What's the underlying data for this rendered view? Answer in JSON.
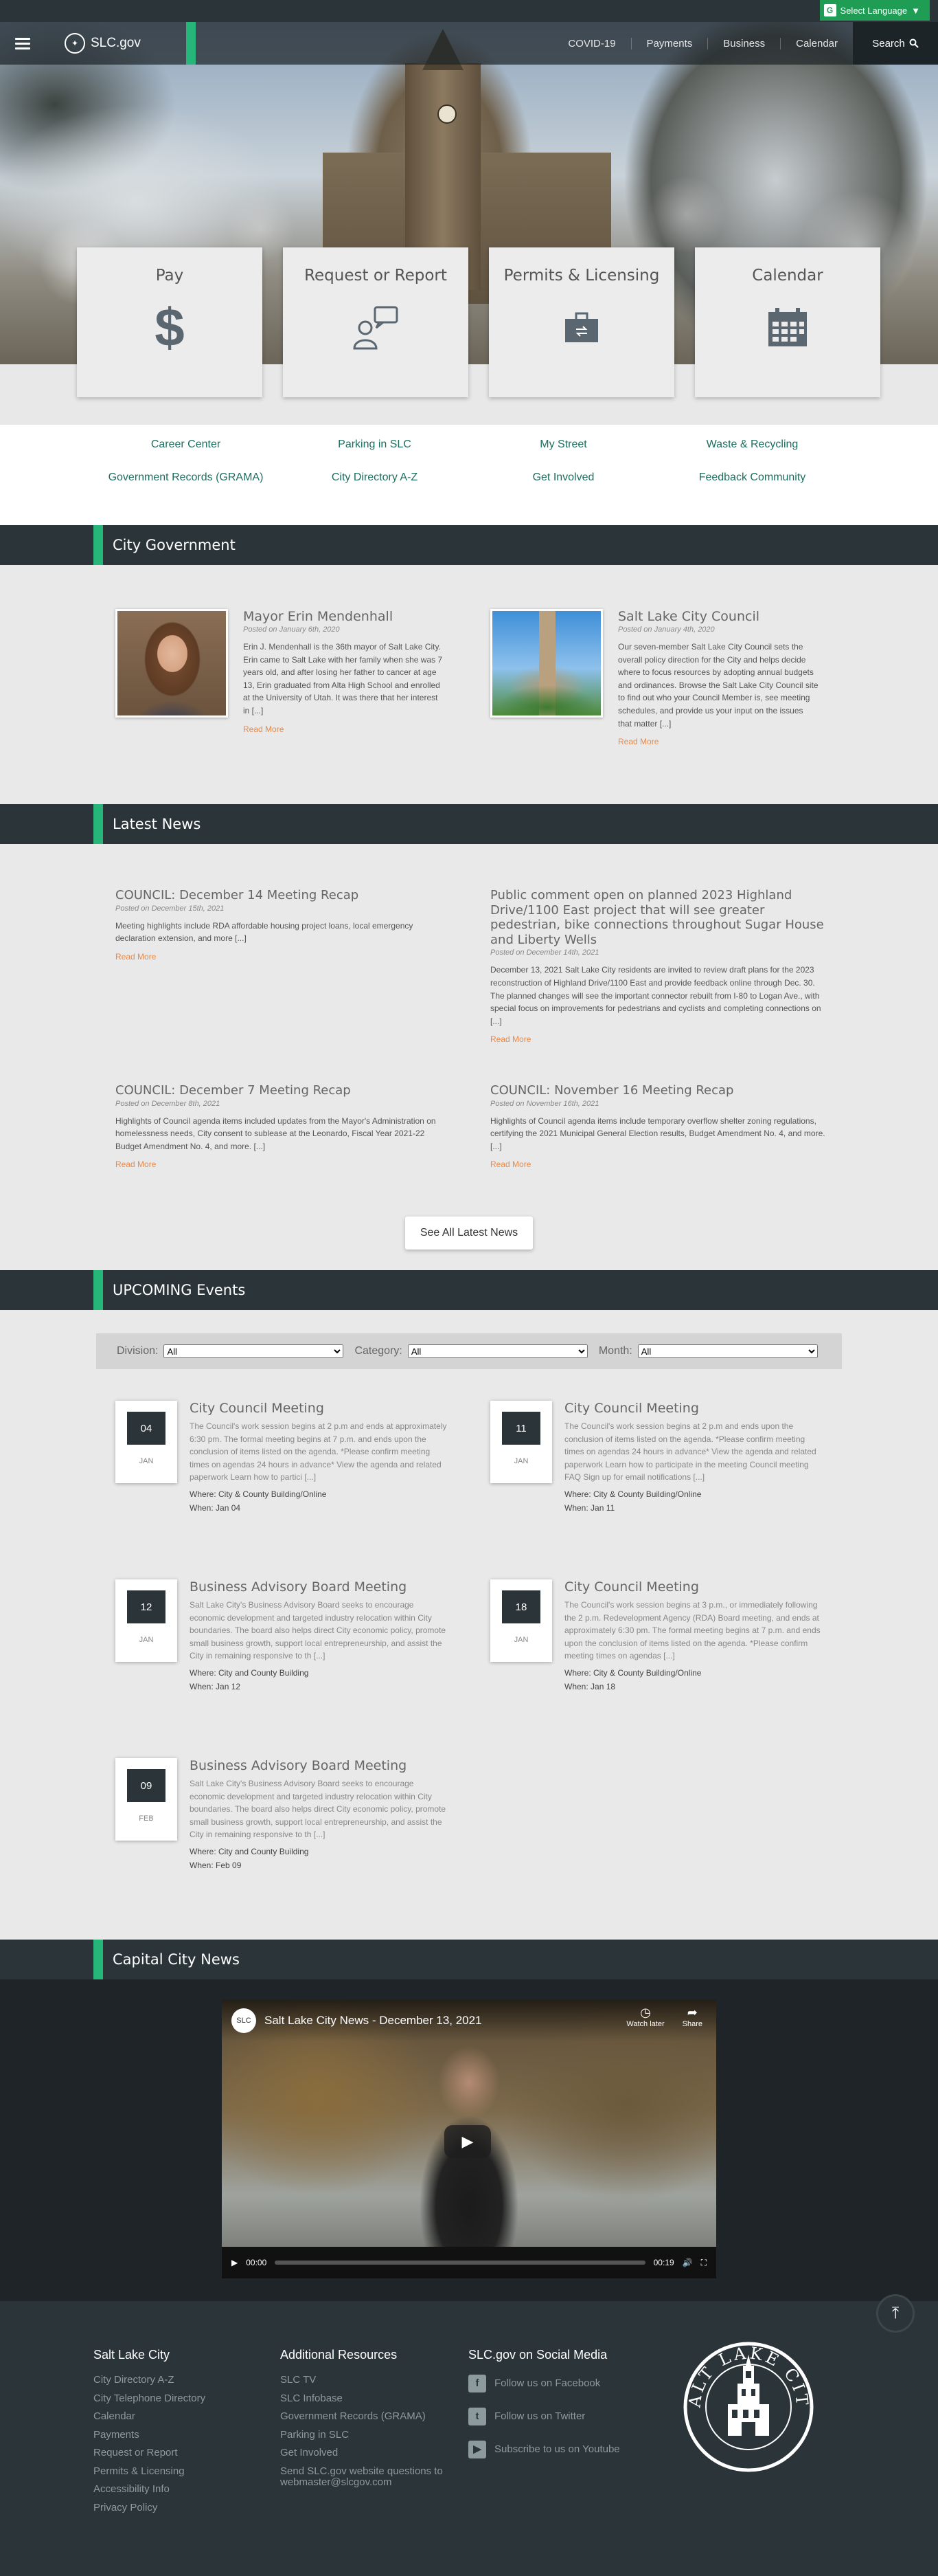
{
  "language": {
    "label": "Select Language"
  },
  "header": {
    "logo": "SLC.gov",
    "nav": [
      "COVID-19",
      "Payments",
      "Business",
      "Calendar"
    ],
    "search_label": "Search"
  },
  "quick_cards": [
    {
      "label": "Pay",
      "icon": "dollar-icon"
    },
    {
      "label": "Request or Report",
      "icon": "person-chat-icon"
    },
    {
      "label": "Permits & Licensing",
      "icon": "briefcase-icon"
    },
    {
      "label": "Calendar",
      "icon": "calendar-icon"
    }
  ],
  "quick_links": [
    [
      "Career Center",
      "Parking in SLC",
      "My Street",
      "Waste & Recycling"
    ],
    [
      "Government Records (GRAMA)",
      "City Directory A-Z",
      "Get Involved",
      "Feedback Community"
    ]
  ],
  "city_government": {
    "heading": "City Government",
    "items": [
      {
        "title": "Mayor Erin Mendenhall",
        "date": "Posted on January 6th, 2020",
        "body": "Erin J. Mendenhall is the 36th mayor of Salt Lake City. Erin came to Salt Lake with her family when she was 7 years old, and after losing her father to cancer at age 13, Erin graduated from Alta High School and enrolled at the University of Utah. It was there that her interest in [...]",
        "more": "Read More"
      },
      {
        "title": "Salt Lake City Council",
        "date": "Posted on January 4th, 2020",
        "body": "Our seven-member Salt Lake City Council sets the overall policy direction for the City and helps decide where to focus resources by adopting annual budgets and ordinances. Browse the Salt Lake City Council site to find out who your Council Member is, see meeting schedules, and provide us your input on the issues that matter [...]",
        "more": "Read More"
      }
    ]
  },
  "latest_news": {
    "heading": "Latest News",
    "items": [
      {
        "title": "COUNCIL: December 14 Meeting Recap",
        "date": "Posted on December 15th, 2021",
        "body": "Meeting highlights include RDA affordable housing project loans, local emergency declaration extension, and more [...]",
        "more": "Read More"
      },
      {
        "title": "Public comment open on planned 2023 Highland Drive/1100 East project that will see greater pedestrian, bike connections throughout Sugar House and Liberty Wells",
        "date": "Posted on December 14th, 2021",
        "body": "December 13, 2021 Salt Lake City residents are invited to review draft plans for the 2023 reconstruction of Highland Drive/1100 East and provide feedback online through Dec. 30. The planned changes will see the important connector rebuilt from I-80 to Logan Ave., with special focus on improvements for pedestrians and cyclists and completing connections on [...]",
        "more": "Read More"
      },
      {
        "title": "COUNCIL: December 7 Meeting Recap",
        "date": "Posted on December 8th, 2021",
        "body": "Highlights of Council agenda items included updates from the Mayor's Administration on homelessness needs, City consent to sublease at the Leonardo, Fiscal Year 2021-22 Budget Amendment No. 4, and more. [...]",
        "more": "Read More"
      },
      {
        "title": "COUNCIL: November 16 Meeting Recap",
        "date": "Posted on November 16th, 2021",
        "body": "Highlights of Council agenda items include temporary overflow shelter zoning regulations, certifying the 2021 Municipal General Election results, Budget Amendment No. 4, and more. [...]",
        "more": "Read More"
      }
    ],
    "see_all": "See All Latest News"
  },
  "events": {
    "heading": "UPCOMING Events",
    "filters": [
      {
        "label": "Division:",
        "value": "All"
      },
      {
        "label": "Category:",
        "value": "All"
      },
      {
        "label": "Month:",
        "value": "All"
      }
    ],
    "items": [
      {
        "day": "04",
        "month": "JAN",
        "title": "City Council Meeting",
        "body": "The Council's work session begins at 2 p.m and ends at approximately 6:30 pm. The formal meeting begins at 7 p.m. and ends upon the conclusion of items listed on the agenda. *Please confirm meeting times on agendas 24 hours in advance* View the agenda and related paperwork Learn how to partici [...]",
        "where": "Where: City & County Building/Online",
        "when": "When: Jan 04"
      },
      {
        "day": "11",
        "month": "JAN",
        "title": "City Council Meeting",
        "body": "The Council's work session begins at 2 p.m and ends upon the conclusion of items listed on the agenda. *Please confirm meeting times on agendas 24 hours in advance* View the agenda and related paperwork Learn how to participate in the meeting Council meeting FAQ Sign up for email notifications [...]",
        "where": "Where: City & County Building/Online",
        "when": "When: Jan 11"
      },
      {
        "day": "12",
        "month": "JAN",
        "title": "Business Advisory Board Meeting",
        "body": "Salt Lake City's Business Advisory Board seeks to encourage economic development and targeted industry relocation within City boundaries. The board also helps direct City economic policy, promote small business growth, support local entrepreneurship, and assist the City in remaining responsive to th [...]",
        "where": "Where: City and County Building",
        "when": "When: Jan 12"
      },
      {
        "day": "18",
        "month": "JAN",
        "title": "City Council Meeting",
        "body": "The Council's work session begins at 3 p.m., or immediately following the 2 p.m. Redevelopment Agency (RDA) Board meeting, and ends at approximately 6:30 pm. The formal meeting begins at 7 p.m. and ends upon the conclusion of items listed on the agenda. *Please confirm meeting times on agendas [...]",
        "where": "Where: City & County Building/Online",
        "when": "When: Jan 18"
      },
      {
        "day": "09",
        "month": "FEB",
        "title": "Business Advisory Board Meeting",
        "body": "Salt Lake City's Business Advisory Board seeks to encourage economic development and targeted industry relocation within City boundaries. The board also helps direct City economic policy, promote small business growth, support local entrepreneurship, and assist the City in remaining responsive to th [...]",
        "where": "Where: City and County Building",
        "when": "When: Feb 09"
      }
    ]
  },
  "capital_news": {
    "heading": "Capital City News",
    "video_title": "Salt Lake City News - December 13, 2021",
    "watch_later": "Watch later",
    "share": "Share",
    "time_current": "00:00",
    "time_total": "00:19"
  },
  "footer": {
    "col1": {
      "heading": "Salt Lake City",
      "links": [
        "City Directory A-Z",
        "City Telephone Directory",
        "Calendar",
        "Payments",
        "Request or Report",
        "Permits & Licensing",
        "Accessibility Info",
        "Privacy Policy"
      ]
    },
    "col2": {
      "heading": "Additional Resources",
      "links": [
        "SLC TV",
        "SLC Infobase",
        "Government Records (GRAMA)",
        "Parking in SLC",
        "Get Involved",
        "Send SLC.gov website questions to webmaster@slcgov.com"
      ]
    },
    "col3": {
      "heading": "SLC.gov on Social Media",
      "links": [
        "Follow us on Facebook",
        "Follow us on Twitter",
        "Subscribe to us on Youtube"
      ]
    },
    "seal_text": "SALT LAKE CITY"
  }
}
